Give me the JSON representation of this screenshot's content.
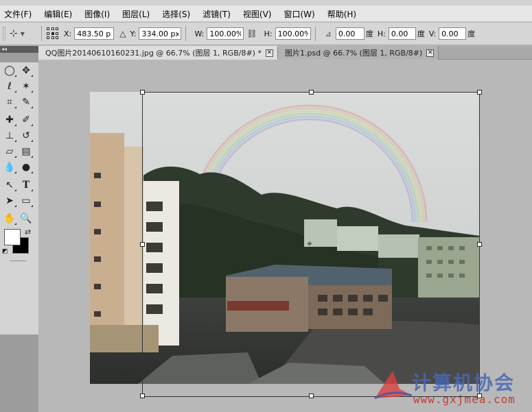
{
  "menu": [
    "文件(F)",
    "编辑(E)",
    "图像(I)",
    "图层(L)",
    "选择(S)",
    "滤镜(T)",
    "视图(V)",
    "窗口(W)",
    "帮助(H)"
  ],
  "options": {
    "x_label": "X:",
    "x_value": "483.50 px",
    "y_label": "Y:",
    "y_value": "334.00 px",
    "w_label": "W:",
    "w_value": "100.00%",
    "h_label": "H:",
    "h_value": "100.00%",
    "angle_value": "0.00",
    "angle_unit": "度",
    "hskew_label": "H:",
    "hskew_value": "0.00",
    "hskew_unit": "度",
    "vskew_label": "V:",
    "vskew_value": "0.00",
    "vskew_unit": "度"
  },
  "tabs": [
    {
      "label": "QQ图片20140610160231.jpg @ 66.7% (图层 1, RGB/8#) *",
      "active": true
    },
    {
      "label": "图片1.psd @ 66.7% (图层 1, RGB/8#)",
      "active": false
    }
  ],
  "tools": {
    "icons": [
      "elliptical-marquee-icon",
      "move-icon",
      "lasso-icon",
      "magic-wand-icon",
      "crop-icon",
      "eyedropper-icon",
      "healing-brush-icon",
      "brush-icon",
      "clone-stamp-icon",
      "history-brush-icon",
      "eraser-icon",
      "gradient-icon",
      "blur-icon",
      "dodge-icon",
      "path-selection-icon",
      "type-icon",
      "direct-selection-icon",
      "rectangle-shape-icon",
      "hand-icon",
      "zoom-icon"
    ],
    "foreground_color": "#ffffff",
    "background_color": "#000000"
  },
  "watermark": {
    "text": "计算机协会",
    "url": "www.gxjmea.com"
  }
}
